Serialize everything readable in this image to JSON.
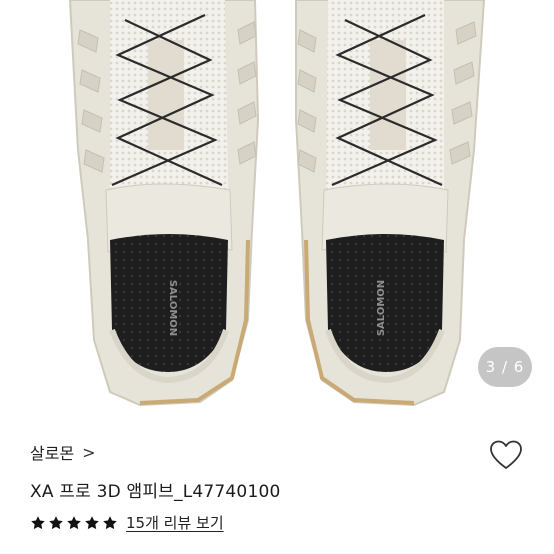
{
  "gallery": {
    "image_alt": "SALOMON XA Pro 3D sneakers, cream colorway",
    "insole_logo": "SALOMON",
    "current_page": "3",
    "total_pages": "6",
    "indicator_text": "3 / 6"
  },
  "product": {
    "brand": "살로몬",
    "brand_chevron": ">",
    "name": "XA 프로 3D 앰피브_L47740100",
    "wish_icon": "heart-outline-icon"
  },
  "rating": {
    "stars": 5,
    "max": 5,
    "review_link": "15개 리뷰 보기"
  },
  "colors": {
    "star": "#111111",
    "shoe_body": "#e4e1d6",
    "insole": "#1c1c1c",
    "sole_trim": "#c9a974"
  }
}
